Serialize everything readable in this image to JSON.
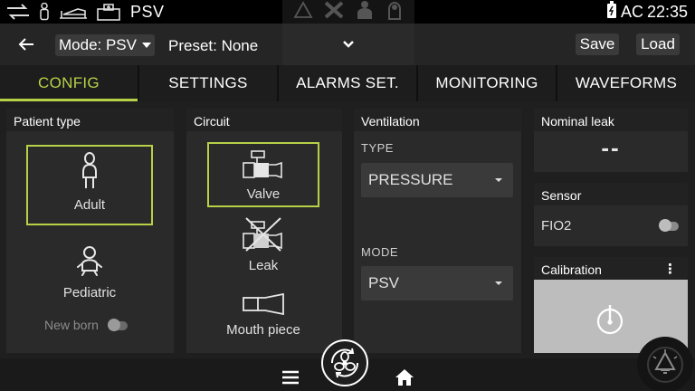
{
  "status_bar": {
    "mode_text": "PSV",
    "power_text": "AC",
    "time": "22:35",
    "icons": [
      "swap-icon",
      "person-icon",
      "patient-bed-icon",
      "hospital-icon",
      "warning-triangle-icon",
      "tools-icon",
      "doctor-icon",
      "nurse-icon",
      "battery-icon"
    ]
  },
  "header": {
    "mode_select": "Mode: PSV",
    "preset": "Preset: None",
    "save_label": "Save",
    "load_label": "Load"
  },
  "tabs": [
    {
      "label": "CONFIG",
      "active": true
    },
    {
      "label": "SETTINGS",
      "active": false
    },
    {
      "label": "ALARMS SET.",
      "active": false
    },
    {
      "label": "MONITORING",
      "active": false
    },
    {
      "label": "WAVEFORMS",
      "active": false
    }
  ],
  "patient_type": {
    "title": "Patient type",
    "adult": "Adult",
    "pediatric": "Pediatric",
    "newborn": "New born",
    "selected": "Adult"
  },
  "circuit": {
    "title": "Circuit",
    "valve": "Valve",
    "leak": "Leak",
    "mouthpiece": "Mouth piece",
    "selected": "Valve"
  },
  "ventilation": {
    "title": "Ventilation",
    "type_label": "TYPE",
    "type_value": "PRESSURE",
    "mode_label": "MODE",
    "mode_value": "PSV"
  },
  "nominal_leak": {
    "title": "Nominal leak",
    "value": "--"
  },
  "sensor": {
    "title": "Sensor",
    "fio2_label": "FIO2"
  },
  "calibration": {
    "title": "Calibration"
  },
  "colors": {
    "accent": "#b7d147",
    "background": "#1f1f1f",
    "panel": "#2a2a2a"
  }
}
